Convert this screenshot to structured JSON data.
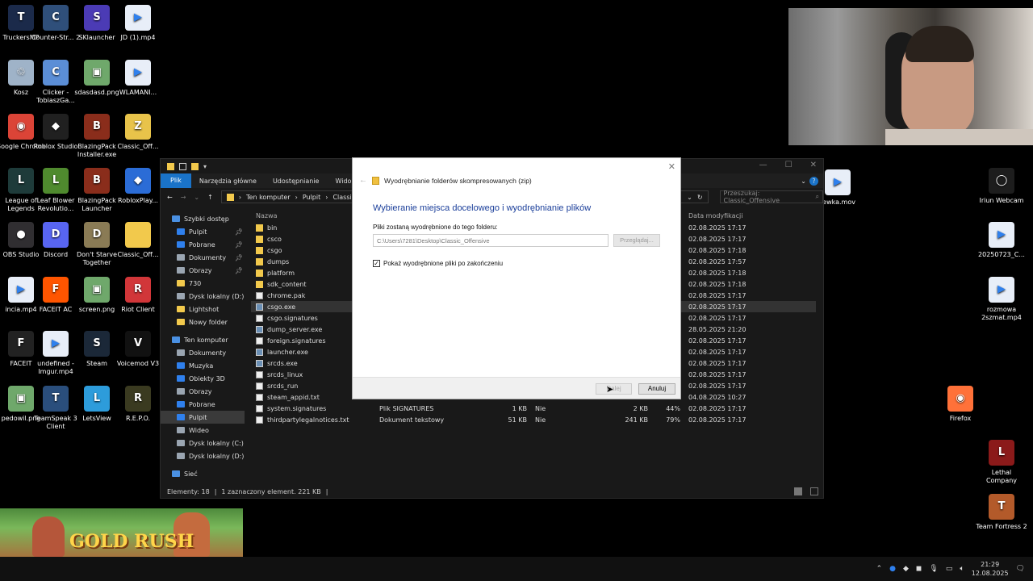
{
  "desktop_icons_left": [
    {
      "label": "TruckersMP",
      "color": "#1b2a4a",
      "glyph": "T"
    },
    {
      "label": "Counter-Str... 2",
      "color": "#2f4f7a",
      "glyph": "C"
    },
    {
      "label": "SKlauncher",
      "color": "#4b3bb5",
      "glyph": "S"
    },
    {
      "label": "JD (1).mp4",
      "color": "#e8eef8",
      "glyph": "▶"
    },
    {
      "label": "Kosz",
      "color": "#9fb3c8",
      "glyph": "♲"
    },
    {
      "label": "Clicker - TobiaszGa...",
      "color": "#5b8ed6",
      "glyph": "C"
    },
    {
      "label": "sdasdasd.png",
      "color": "#6fa86b",
      "glyph": "▣"
    },
    {
      "label": "WLAMANI...",
      "color": "#e8eef8",
      "glyph": "▶"
    },
    {
      "label": "Google Chrome",
      "color": "#db4437",
      "glyph": "◉"
    },
    {
      "label": "Roblox Studio",
      "color": "#202020",
      "glyph": "◆"
    },
    {
      "label": "BlazingPack Installer.exe",
      "color": "#8a2d1b",
      "glyph": "B"
    },
    {
      "label": "Classic_Off...",
      "color": "#e8c34a",
      "glyph": "Z"
    },
    {
      "label": "League of Legends",
      "color": "#1e3b3a",
      "glyph": "L"
    },
    {
      "label": "Leaf Blower Revolutio...",
      "color": "#4f8a2e",
      "glyph": "L"
    },
    {
      "label": "BlazingPack Launcher",
      "color": "#8a2d1b",
      "glyph": "B"
    },
    {
      "label": "RobloxPlay...",
      "color": "#2b6cd6",
      "glyph": "◆"
    },
    {
      "label": "OBS Studio",
      "color": "#302e31",
      "glyph": "●"
    },
    {
      "label": "Discord",
      "color": "#5865f2",
      "glyph": "D"
    },
    {
      "label": "Don't Starve Together",
      "color": "#8a7b55",
      "glyph": "D"
    },
    {
      "label": "Classic_Off...",
      "color": "#f2c94c",
      "glyph": ""
    },
    {
      "label": "incia.mp4",
      "color": "#e8eef8",
      "glyph": "▶"
    },
    {
      "label": "FACEIT AC",
      "color": "#ff5500",
      "glyph": "F"
    },
    {
      "label": "screen.png",
      "color": "#6fa86b",
      "glyph": "▣"
    },
    {
      "label": "Riot Client",
      "color": "#d13639",
      "glyph": "R"
    },
    {
      "label": "FACEIT",
      "color": "#222222",
      "glyph": "F"
    },
    {
      "label": "undefined - Imgur.mp4",
      "color": "#e8eef8",
      "glyph": "▶"
    },
    {
      "label": "Steam",
      "color": "#1b2838",
      "glyph": "S"
    },
    {
      "label": "Voicemod V3",
      "color": "#111111",
      "glyph": "V"
    },
    {
      "label": "pedowil.png",
      "color": "#6fa86b",
      "glyph": "▣"
    },
    {
      "label": "TeamSpeak 3 Client",
      "color": "#2a4e7c",
      "glyph": "T"
    },
    {
      "label": "LetsView",
      "color": "#2d9cdb",
      "glyph": "L"
    },
    {
      "label": "R.E.P.O.",
      "color": "#3a3a20",
      "glyph": "R"
    }
  ],
  "desktop_icons_right": [
    {
      "label": "rewka.mov",
      "color": "#e8eef8",
      "glyph": "▶"
    },
    {
      "label": "Iriun Webcam",
      "color": "#1d1d1d",
      "glyph": "◯"
    },
    {
      "label": "20250723_C...",
      "color": "#e8eef8",
      "glyph": "▶"
    },
    {
      "label": "rozmowa 2szmat.mp4",
      "color": "#e8eef8",
      "glyph": "▶"
    },
    {
      "label": "Firefox",
      "color": "#ff7139",
      "glyph": "◉"
    },
    {
      "label": "Lethal Company",
      "color": "#8b1a1a",
      "glyph": "L"
    },
    {
      "label": "Team Fortress 2",
      "color": "#b35a2a",
      "glyph": "T"
    }
  ],
  "game_banner": {
    "title": "GOLD RUSH"
  },
  "explorer": {
    "tabs": [
      "Plik",
      "Narzędzia główne",
      "Udostępnianie",
      "Widok"
    ],
    "breadcrumb": [
      "Ten komputer",
      "Pulpit",
      "Classic_Offe"
    ],
    "search_placeholder": "Przeszukaj: Classic_Offensive",
    "nav": [
      {
        "label": "Szybki dostęp",
        "color": "#4a90e2",
        "indent": 0,
        "pin": false
      },
      {
        "label": "Pulpit",
        "color": "#2f80ed",
        "indent": 1,
        "pin": true
      },
      {
        "label": "Pobrane",
        "color": "#2f80ed",
        "indent": 1,
        "pin": true
      },
      {
        "label": "Dokumenty",
        "color": "#9aa5b1",
        "indent": 1,
        "pin": true
      },
      {
        "label": "Obrazy",
        "color": "#9aa5b1",
        "indent": 1,
        "pin": true
      },
      {
        "label": "730",
        "color": "#f2c94c",
        "indent": 1,
        "pin": false
      },
      {
        "label": "Dysk lokalny (D:)",
        "color": "#9aa5b1",
        "indent": 1,
        "pin": false
      },
      {
        "label": "Lightshot",
        "color": "#f2c94c",
        "indent": 1,
        "pin": false
      },
      {
        "label": "Nowy folder",
        "color": "#f2c94c",
        "indent": 1,
        "pin": false
      },
      {
        "label": "Ten komputer",
        "color": "#4a90e2",
        "indent": 0,
        "pin": false
      },
      {
        "label": "Dokumenty",
        "color": "#9aa5b1",
        "indent": 1,
        "pin": false
      },
      {
        "label": "Muzyka",
        "color": "#2f80ed",
        "indent": 1,
        "pin": false
      },
      {
        "label": "Obiekty 3D",
        "color": "#2f80ed",
        "indent": 1,
        "pin": false
      },
      {
        "label": "Obrazy",
        "color": "#9aa5b1",
        "indent": 1,
        "pin": false
      },
      {
        "label": "Pobrane",
        "color": "#2f80ed",
        "indent": 1,
        "pin": false
      },
      {
        "label": "Pulpit",
        "color": "#2f80ed",
        "indent": 1,
        "pin": false,
        "selected": true
      },
      {
        "label": "Wideo",
        "color": "#9aa5b1",
        "indent": 1,
        "pin": false
      },
      {
        "label": "Dysk lokalny (C:)",
        "color": "#9aa5b1",
        "indent": 1,
        "pin": false
      },
      {
        "label": "Dysk lokalny (D:)",
        "color": "#9aa5b1",
        "indent": 1,
        "pin": false
      },
      {
        "label": "Sieć",
        "color": "#4a90e2",
        "indent": 0,
        "pin": false
      }
    ],
    "columns": {
      "name": "Nazwa",
      "date": "Data modyfikacji"
    },
    "files": [
      {
        "name": "bin",
        "kind": "folder",
        "type": "",
        "size": "",
        "protected": "",
        "packed": "",
        "ratio": "",
        "date": "02.08.2025 17:17"
      },
      {
        "name": "csco",
        "kind": "folder",
        "type": "",
        "size": "",
        "protected": "",
        "packed": "",
        "ratio": "",
        "date": "02.08.2025 17:17"
      },
      {
        "name": "csgo",
        "kind": "folder",
        "type": "",
        "size": "",
        "protected": "",
        "packed": "",
        "ratio": "",
        "date": "02.08.2025 17:18"
      },
      {
        "name": "dumps",
        "kind": "folder",
        "type": "",
        "size": "",
        "protected": "",
        "packed": "",
        "ratio": "",
        "date": "02.08.2025 17:57"
      },
      {
        "name": "platform",
        "kind": "folder",
        "type": "",
        "size": "",
        "protected": "",
        "packed": "",
        "ratio": "",
        "date": "02.08.2025 17:18"
      },
      {
        "name": "sdk_content",
        "kind": "folder",
        "type": "",
        "size": "",
        "protected": "",
        "packed": "",
        "ratio": "",
        "date": "02.08.2025 17:18"
      },
      {
        "name": "chrome.pak",
        "kind": "file",
        "type": "",
        "size": "",
        "protected": "",
        "packed": "",
        "ratio": "",
        "date": "02.08.2025 17:17"
      },
      {
        "name": "csgo.exe",
        "kind": "exe",
        "type": "",
        "size": "",
        "protected": "",
        "packed": "",
        "ratio": "",
        "date": "02.08.2025 17:17",
        "selected": true
      },
      {
        "name": "csgo.signatures",
        "kind": "file",
        "type": "",
        "size": "",
        "protected": "",
        "packed": "",
        "ratio": "",
        "date": "02.08.2025 17:17"
      },
      {
        "name": "dump_server.exe",
        "kind": "exe",
        "type": "",
        "size": "",
        "protected": "",
        "packed": "",
        "ratio": "",
        "date": "28.05.2025 21:20"
      },
      {
        "name": "foreign.signatures",
        "kind": "file",
        "type": "",
        "size": "",
        "protected": "",
        "packed": "",
        "ratio": "",
        "date": "02.08.2025 17:17"
      },
      {
        "name": "launcher.exe",
        "kind": "exe",
        "type": "",
        "size": "",
        "protected": "",
        "packed": "",
        "ratio": "",
        "date": "02.08.2025 17:17"
      },
      {
        "name": "srcds.exe",
        "kind": "exe",
        "type": "",
        "size": "",
        "protected": "",
        "packed": "",
        "ratio": "",
        "date": "02.08.2025 17:17"
      },
      {
        "name": "srcds_linux",
        "kind": "file",
        "type": "",
        "size": "",
        "protected": "",
        "packed": "",
        "ratio": "",
        "date": "02.08.2025 17:17"
      },
      {
        "name": "srcds_run",
        "kind": "file",
        "type": "",
        "size": "",
        "protected": "",
        "packed": "",
        "ratio": "",
        "date": "02.08.2025 17:17"
      },
      {
        "name": "steam_appid.txt",
        "kind": "file",
        "type": "",
        "size": "",
        "protected": "",
        "packed": "",
        "ratio": "",
        "date": "04.08.2025 10:27"
      },
      {
        "name": "system.signatures",
        "kind": "file",
        "type": "Plik SIGNATURES",
        "size": "1 KB",
        "protected": "Nie",
        "packed": "2 KB",
        "ratio": "44%",
        "date": "02.08.2025 17:17"
      },
      {
        "name": "thirdpartylegalnotices.txt",
        "kind": "file",
        "type": "Dokument tekstowy",
        "size": "51 KB",
        "protected": "Nie",
        "packed": "241 KB",
        "ratio": "79%",
        "date": "02.08.2025 17:17"
      }
    ],
    "status": {
      "count": "Elementy: 18",
      "selected": "1 zaznaczony element. 221 KB"
    }
  },
  "dialog": {
    "header": "Wyodrębnianie folderów skompresowanych (zip)",
    "title": "Wybieranie miejsca docelowego i wyodrębnianie plików",
    "label": "Pliki zostaną wyodrębnione do tego folderu:",
    "path": "C:\\Users\\7281\\Desktop\\Classic_Offensive",
    "browse": "Przeglądaj...",
    "checkbox": "Pokaż wyodrębnione pliki po zakończeniu",
    "checked": true,
    "next": "Dalej",
    "cancel": "Anuluj"
  },
  "taskbar": {
    "time": "21:29",
    "date": "12.08.2025"
  }
}
